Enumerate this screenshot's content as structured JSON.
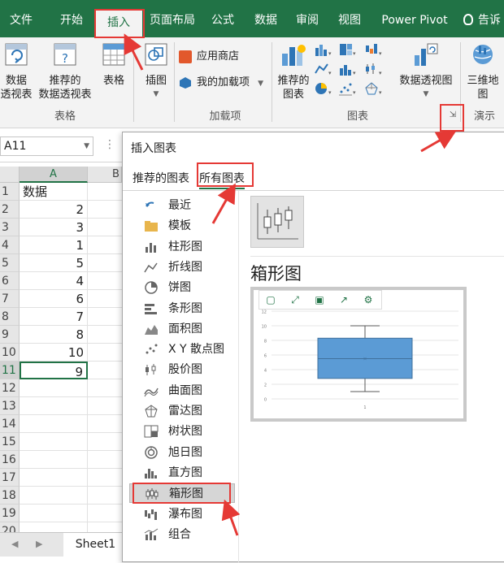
{
  "ribbon_tabs": [
    "文件",
    "开始",
    "插入",
    "页面布局",
    "公式",
    "数据",
    "审阅",
    "视图",
    "Power Pivot",
    "告诉我"
  ],
  "active_tab": "插入",
  "ribbon": {
    "pivot_label_1": "数据",
    "pivot_label_2": "透视表",
    "recpivot_label_1": "推荐的",
    "recpivot_label_2": "数据透视表",
    "table_label": "表格",
    "group_tables": "表格",
    "illustrations_label": "插图",
    "store_label": "应用商店",
    "myaddins_label": "我的加载项",
    "group_addins": "加载项",
    "rec_charts_1": "推荐的",
    "rec_charts_2": "图表",
    "pivotchart_label": "数据透视图",
    "group_charts": "图表",
    "map3d_1": "三维地",
    "map3d_2": "图",
    "group_tours": "演示"
  },
  "namebox": "A11",
  "grid": {
    "col_a": "A",
    "col_b": "B",
    "rows": [
      {
        "n": "1",
        "v": "数据",
        "type": "txt"
      },
      {
        "n": "2",
        "v": "2",
        "type": "num"
      },
      {
        "n": "3",
        "v": "3",
        "type": "num"
      },
      {
        "n": "4",
        "v": "1",
        "type": "num"
      },
      {
        "n": "5",
        "v": "5",
        "type": "num"
      },
      {
        "n": "6",
        "v": "4",
        "type": "num"
      },
      {
        "n": "7",
        "v": "6",
        "type": "num"
      },
      {
        "n": "8",
        "v": "7",
        "type": "num"
      },
      {
        "n": "9",
        "v": "8",
        "type": "num"
      },
      {
        "n": "10",
        "v": "10",
        "type": "num"
      },
      {
        "n": "11",
        "v": "9",
        "type": "num"
      },
      {
        "n": "12",
        "v": "",
        "type": "txt"
      },
      {
        "n": "13",
        "v": "",
        "type": "txt"
      },
      {
        "n": "14",
        "v": "",
        "type": "txt"
      },
      {
        "n": "15",
        "v": "",
        "type": "txt"
      },
      {
        "n": "16",
        "v": "",
        "type": "txt"
      },
      {
        "n": "17",
        "v": "",
        "type": "txt"
      },
      {
        "n": "18",
        "v": "",
        "type": "txt"
      },
      {
        "n": "19",
        "v": "",
        "type": "txt"
      },
      {
        "n": "20",
        "v": "",
        "type": "txt"
      }
    ],
    "selected_row": "11"
  },
  "sheet_tab": "Sheet1",
  "dialog": {
    "title": "插入图表",
    "tab_recommended": "推荐的图表",
    "tab_all": "所有图表",
    "chart_types": [
      "最近",
      "模板",
      "柱形图",
      "折线图",
      "饼图",
      "条形图",
      "面积图",
      "X Y 散点图",
      "股价图",
      "曲面图",
      "雷达图",
      "树状图",
      "旭日图",
      "直方图",
      "箱形图",
      "瀑布图",
      "组合"
    ],
    "selected_type": "箱形图",
    "preview_heading": "箱形图"
  },
  "chart_data": {
    "type": "box",
    "categories": [
      "1"
    ],
    "yticks": [
      0,
      2,
      4,
      6,
      8,
      10,
      12
    ],
    "ylim": [
      0,
      12
    ],
    "box": {
      "min": 1,
      "q1": 2.8,
      "median": 5.5,
      "q3": 8.3,
      "max": 10,
      "mean": 5.5
    },
    "colors": {
      "box": "#5b9bd5",
      "whisker": "#595959"
    }
  },
  "colors": {
    "excel_green": "#217346",
    "annotation_red": "#e53935"
  }
}
